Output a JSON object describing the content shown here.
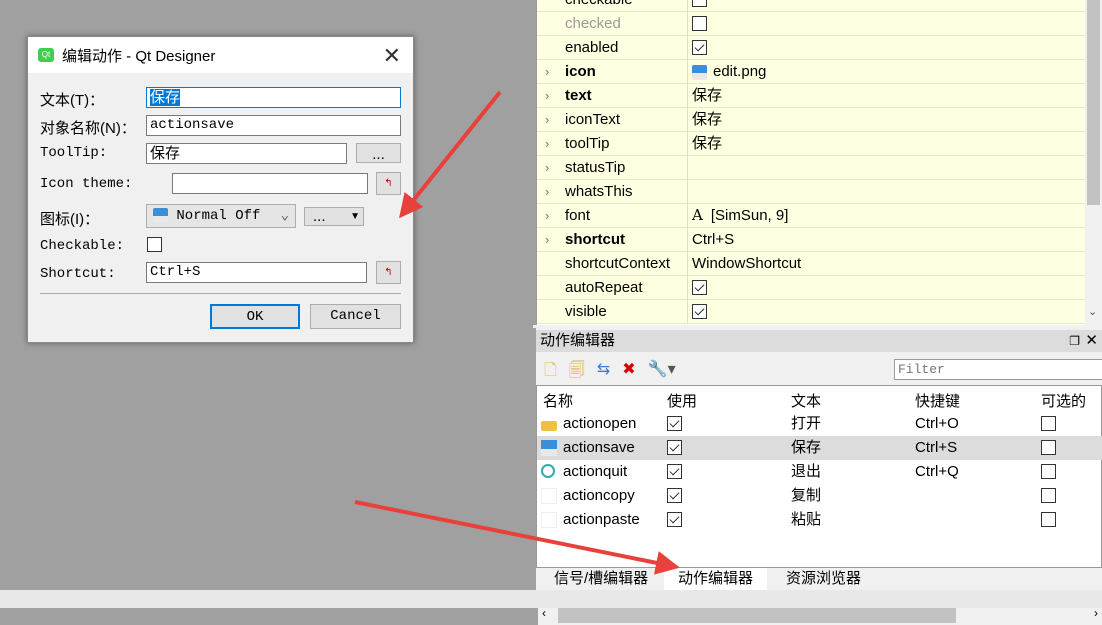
{
  "dialog": {
    "title": "编辑动作 - Qt Designer",
    "text_label": "文本(T)：",
    "text_value": "保存",
    "name_label": "对象名称(N)：",
    "name_value": "actionsave",
    "tooltip_label": "ToolTip:",
    "tooltip_value": "保存",
    "more": "...",
    "icon_theme_label": "Icon theme:",
    "icon_theme_value": "",
    "icon_label": "图标(I)：",
    "icon_mode": "Normal Off",
    "icon_more": "...",
    "checkable_label": "Checkable:",
    "checkable": false,
    "shortcut_label": "Shortcut:",
    "shortcut_value": "Ctrl+S",
    "ok": "OK",
    "cancel": "Cancel"
  },
  "properties": [
    {
      "name": "checkable",
      "value": "",
      "check": false
    },
    {
      "name": "checked",
      "value": "",
      "check": false,
      "disabled": true
    },
    {
      "name": "enabled",
      "value": "",
      "check": true
    },
    {
      "name": "icon",
      "value": "edit.png",
      "expand": true,
      "bold": true,
      "icon": "floppy-icon"
    },
    {
      "name": "text",
      "value": "保存",
      "expand": true,
      "bold": true
    },
    {
      "name": "iconText",
      "value": "保存",
      "expand": true
    },
    {
      "name": "toolTip",
      "value": "保存",
      "expand": true
    },
    {
      "name": "statusTip",
      "value": "",
      "expand": true
    },
    {
      "name": "whatsThis",
      "value": "",
      "expand": true
    },
    {
      "name": "font",
      "value": "[SimSun, 9]",
      "expand": true,
      "icon": "font-icon"
    },
    {
      "name": "shortcut",
      "value": "Ctrl+S",
      "expand": true,
      "bold": true
    },
    {
      "name": "shortcutContext",
      "value": "WindowShortcut"
    },
    {
      "name": "autoRepeat",
      "value": "",
      "check": true
    },
    {
      "name": "visible",
      "value": "",
      "check": true
    }
  ],
  "action_editor": {
    "title": "动作编辑器",
    "filter_placeholder": "Filter",
    "columns": [
      "名称",
      "使用",
      "文本",
      "快捷键",
      "可选的"
    ],
    "rows": [
      {
        "name": "actionopen",
        "used": true,
        "text": "打开",
        "shortcut": "Ctrl+O",
        "checkable": false,
        "icon": "open-folder-icon"
      },
      {
        "name": "actionsave",
        "used": true,
        "text": "保存",
        "shortcut": "Ctrl+S",
        "checkable": false,
        "icon": "floppy-icon",
        "selected": true
      },
      {
        "name": "actionquit",
        "used": true,
        "text": "退出",
        "shortcut": "Ctrl+Q",
        "checkable": false,
        "icon": "quit-icon"
      },
      {
        "name": "actioncopy",
        "used": true,
        "text": "复制",
        "shortcut": "",
        "checkable": false
      },
      {
        "name": "actionpaste",
        "used": true,
        "text": "粘贴",
        "shortcut": "",
        "checkable": false
      }
    ]
  },
  "tabs": [
    "信号/槽编辑器",
    "动作编辑器",
    "资源浏览器"
  ],
  "active_tab": 1,
  "annotation_color": "#e8403a"
}
